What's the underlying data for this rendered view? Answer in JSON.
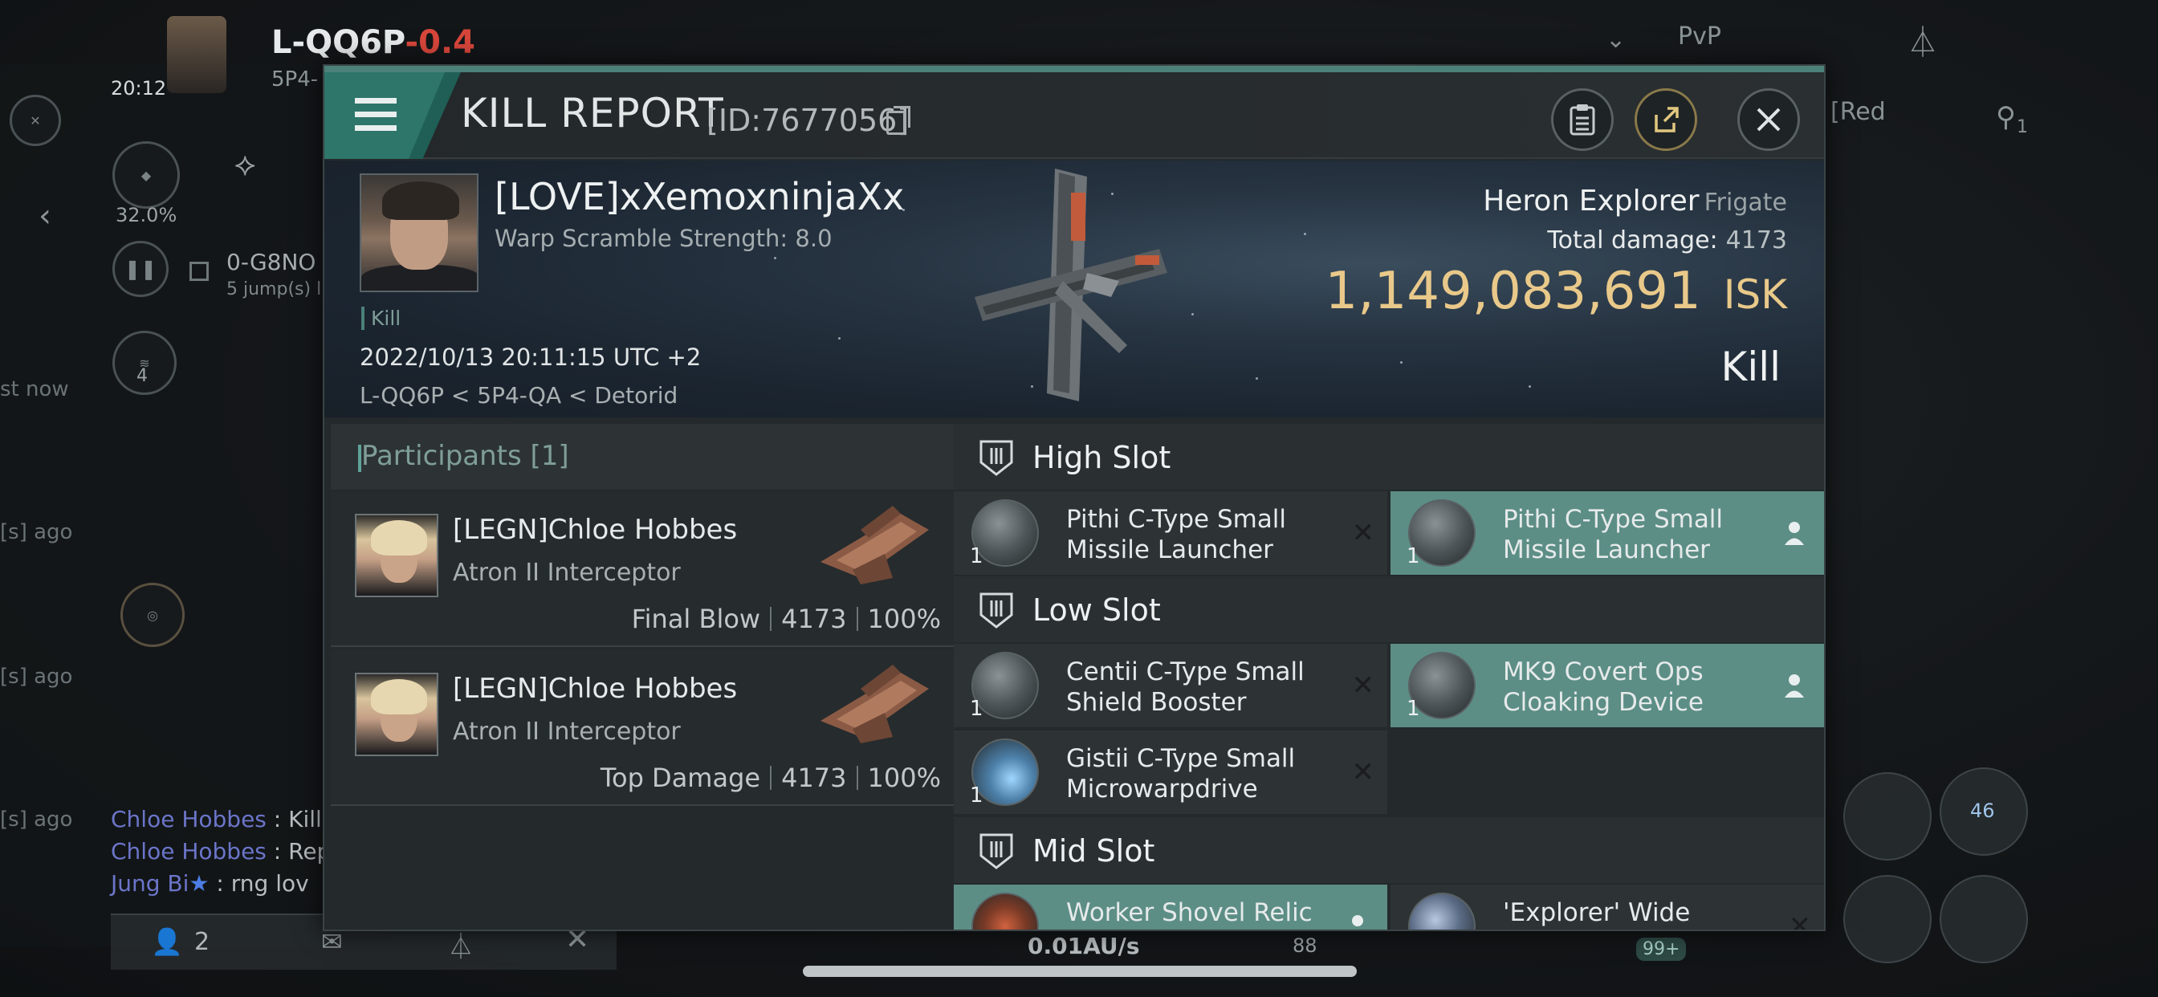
{
  "background": {
    "system_name": "L-QQ6P",
    "security": "-0.4",
    "sub_location": "5P4-",
    "time": "20:12",
    "cargo_percent": "32.0%",
    "route_target": "0-G8NO",
    "route_jumps": "5 jump(s) l",
    "badge_count": "4",
    "pvp_label": "PvP",
    "red_label": "[Red",
    "right_count": "1",
    "ago_1": "[s] ago",
    "ago_2": "[s] ago",
    "ago_3": "[s] ago",
    "ago_4": "st now",
    "chat": [
      {
        "name": "Chloe Hobbes",
        "msg": " : Kill:"
      },
      {
        "name": "Chloe Hobbes",
        "msg": " : Rep"
      },
      {
        "name": "Jung Bi",
        "msg": " : rng lov"
      }
    ],
    "online_count": "2",
    "speed": "0.01AU/s",
    "speed_right": "88",
    "counter_99": "99+",
    "drone_count": "46"
  },
  "modal": {
    "title": "KILL REPORT",
    "report_id": "[ID:7677056]",
    "victim": {
      "name": "[LOVE]xXemoxninjaXx",
      "warp_scramble": "Warp Scramble Strength: 8.0",
      "tag": "Kill",
      "datetime": "2022/10/13 20:11:15 UTC +2",
      "location": "L-QQ6P < 5P4-QA < Detorid"
    },
    "ship": {
      "name": "Heron Explorer",
      "class": "Frigate",
      "total_damage_label": "Total damage:",
      "total_damage": "4173",
      "isk_value": "1,149,083,691",
      "isk_unit": "ISK",
      "result": "Kill"
    },
    "participants": {
      "title": "Participants",
      "count": "[1]",
      "items": [
        {
          "name": "[LEGN]Chloe Hobbes",
          "ship": "Atron II Interceptor",
          "label": "Final Blow",
          "damage": "4173",
          "percent": "100%"
        },
        {
          "name": "[LEGN]Chloe Hobbes",
          "ship": "Atron II Interceptor",
          "label": "Top Damage",
          "damage": "4173",
          "percent": "100%"
        }
      ]
    },
    "slots": {
      "high": {
        "title": "High Slot"
      },
      "low": {
        "title": "Low Slot"
      },
      "mid": {
        "title": "Mid Slot"
      },
      "modules": [
        {
          "name_1": "Pithi C-Type Small",
          "name_2": "Missile Launcher",
          "qty": "1"
        },
        {
          "name_1": "Pithi C-Type Small",
          "name_2": "Missile Launcher",
          "qty": "1"
        },
        {
          "name_1": "Centii C-Type Small",
          "name_2": "Shield Booster",
          "qty": "1"
        },
        {
          "name_1": "MK9 Covert Ops",
          "name_2": "Cloaking Device",
          "qty": "1"
        },
        {
          "name_1": "Gistii C-Type Small",
          "name_2": "Microwarpdrive",
          "qty": "1"
        },
        {
          "name_1": "Worker Shovel Relic",
          "name_2": "",
          "qty": ""
        },
        {
          "name_1": "'Explorer' Wide",
          "name_2": "",
          "qty": ""
        }
      ]
    },
    "colors": {
      "accent": "#4b8179",
      "isk": "#e9c98a",
      "owned_module": "#5c8e86"
    }
  }
}
